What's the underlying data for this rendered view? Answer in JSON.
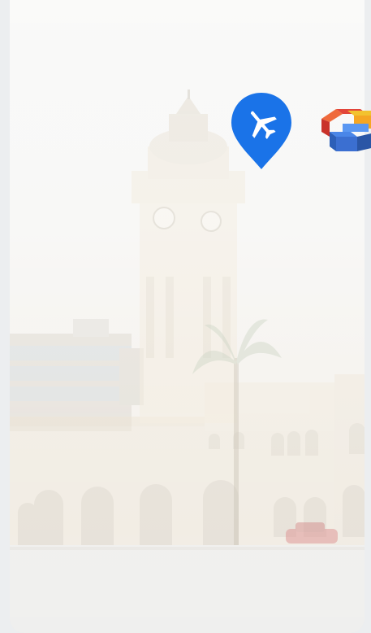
{
  "app": {
    "screen": "splash",
    "accent_color": "#1a73e8"
  },
  "icons": {
    "pin": "airplane-map-pin-icon",
    "partner": "stacked-blocks-logo-icon"
  },
  "background": {
    "subject": "clock-tower-building-photo"
  }
}
